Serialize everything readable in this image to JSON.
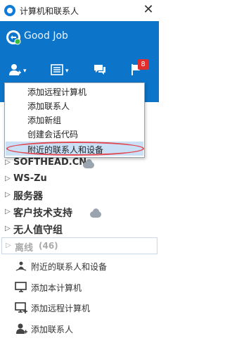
{
  "window": {
    "title": "计算机和联系人",
    "close_glyph": "✕"
  },
  "status": {
    "text": "Good Job"
  },
  "toolbar": {
    "notification_count": "8"
  },
  "menu": {
    "items": [
      {
        "label": "添加远程计算机"
      },
      {
        "label": "添加联系人"
      },
      {
        "label": "添加新组"
      },
      {
        "label": "创建会话代码"
      },
      {
        "label": "附近的联系人和设备",
        "highlighted": true
      }
    ]
  },
  "groups": [
    {
      "name": "SOFTHEAD.CN",
      "cloud": true
    },
    {
      "name": "WS-Zu"
    },
    {
      "name": "服务器"
    },
    {
      "name": "客户技术支持",
      "cloud": true
    },
    {
      "name": "无人值守组"
    }
  ],
  "offline_group": {
    "name": "离线",
    "count": "(46)"
  },
  "actions": [
    {
      "label": "附近的联系人和设备",
      "icon": "nearby-icon"
    },
    {
      "label": "添加本计算机",
      "icon": "monitor-icon"
    },
    {
      "label": "添加远程计算机",
      "icon": "monitor-add-icon"
    },
    {
      "label": "添加联系人",
      "icon": "person-add-icon"
    }
  ],
  "colors": {
    "header_bg": "#0c74c9",
    "highlight": "#c9e0f7",
    "annotation": "#e2464e",
    "badge": "#e22d2d"
  }
}
